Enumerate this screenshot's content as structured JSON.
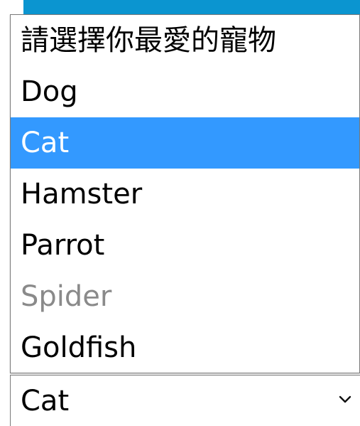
{
  "colors": {
    "accent_strip": "#0b95d0",
    "selected_background": "#3399ff",
    "selected_text": "#ffffff",
    "disabled_text": "#8a8a8a",
    "border": "#7a7a7a"
  },
  "pet_select": {
    "current_value": "Cat",
    "icon": "chevron-down-icon",
    "options": [
      {
        "label": "請選擇你最愛的寵物",
        "selected": false,
        "disabled": false
      },
      {
        "label": "Dog",
        "selected": false,
        "disabled": false
      },
      {
        "label": "Cat",
        "selected": true,
        "disabled": false
      },
      {
        "label": "Hamster",
        "selected": false,
        "disabled": false
      },
      {
        "label": "Parrot",
        "selected": false,
        "disabled": false
      },
      {
        "label": "Spider",
        "selected": false,
        "disabled": true
      },
      {
        "label": "Goldfish",
        "selected": false,
        "disabled": false
      }
    ]
  }
}
